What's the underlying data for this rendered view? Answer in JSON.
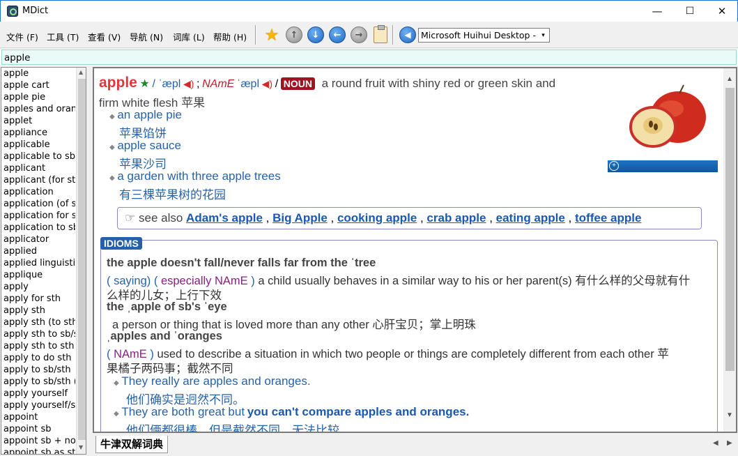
{
  "window": {
    "title": "MDict",
    "minimize": "—",
    "maximize": "☐",
    "close": "✕"
  },
  "menu": [
    "文件 (F)",
    "工具 (T)",
    "查看 (V)",
    "导航 (N)",
    "词库 (L)",
    "帮助 (H)"
  ],
  "toolbar": {
    "dict_select": "Microsoft Huihui Desktop - C",
    "dropdown": "▾"
  },
  "search": {
    "value": "apple"
  },
  "wordlist": [
    "apple",
    "apple cart",
    "apple pie",
    "apples and oranges",
    "applet",
    "appliance",
    "applicable",
    "applicable to sb/sth",
    "applicant",
    "applicant (for sth)",
    "application",
    "application (of sth)",
    "application for sth",
    "application to sb",
    "applicator",
    "applied",
    "applied linguistics",
    "applique",
    "apply",
    "apply for sth",
    "apply sth",
    "apply sth (to sth)",
    "apply sth to sb/sth",
    "apply sth to sth",
    "apply to do sth",
    "apply to sb/sth",
    "apply to sb/sth (for sth)",
    "apply yourself",
    "apply yourself/sth",
    "appoint",
    "appoint sb",
    "appoint sb + noun",
    "appoint sb as sth"
  ],
  "entry": {
    "headword": "apple",
    "star": "★",
    "pron_sep1": "/ ˈæpl",
    "semi": ";",
    "region": "NAmE",
    "pron2": "ˈæpl",
    "pron_sep2": "/",
    "pos": "NOUN",
    "def1": "a round fruit with shiny red or green skin and",
    "def2": "firm white flesh 苹果",
    "examples": [
      {
        "en": "an apple pie",
        "zh": "苹果馅饼"
      },
      {
        "en": "apple sauce",
        "zh": "苹果沙司"
      },
      {
        "en": "a garden with three apple trees",
        "zh": "有三棵苹果树的花园"
      }
    ],
    "see_also_label": "see also",
    "see_also_icon": "☞",
    "see_also": [
      "Adam's apple",
      "Big Apple",
      "cooking apple",
      "crab apple",
      "eating apple",
      "toffee apple"
    ]
  },
  "idioms": {
    "badge": "IDIOMS",
    "i1_head": "the apple doesn't fall/never falls far from the ˈtree",
    "i1_lab_open": "( saying) (",
    "i1_lab_esp": "especially NAmE",
    "i1_lab_close": ")",
    "i1_def": "a child usually behaves in a similar way to his or her parent(s) 有什么样的父母就有什",
    "i1_def2": "么样的儿女；上行下效",
    "i2_head": "the ˌapple of sb's ˈeye",
    "i2_def": "a person or thing that is loved more than any other 心肝宝贝；掌上明珠",
    "i3_head": "ˌapples and ˈoranges",
    "i3_lab_open": "(",
    "i3_lab": "NAmE",
    "i3_lab_close": ")",
    "i3_def": "used to describe a situation in which two people or things are completely different from each other 苹",
    "i3_def2": "果橘子两码事；截然不同",
    "ex1_en": "They really are apples and oranges.",
    "ex1_zh": "他们确实是迥然不同。",
    "ex2_en_a": "They are both great but",
    "ex2_en_b": "you can't compare apples and oranges.",
    "ex2_zh": "他们俩都很棒，但是截然不同，无法比较。"
  },
  "tabs": {
    "active": "牛津双解词典",
    "left": "◀",
    "right": "▶"
  },
  "colors": {
    "headword": "#e2353c",
    "link": "#2762a8",
    "noun_badge": "#a01320",
    "idioms_badge": "#2760a8",
    "search_bg": "#eafaf8"
  }
}
